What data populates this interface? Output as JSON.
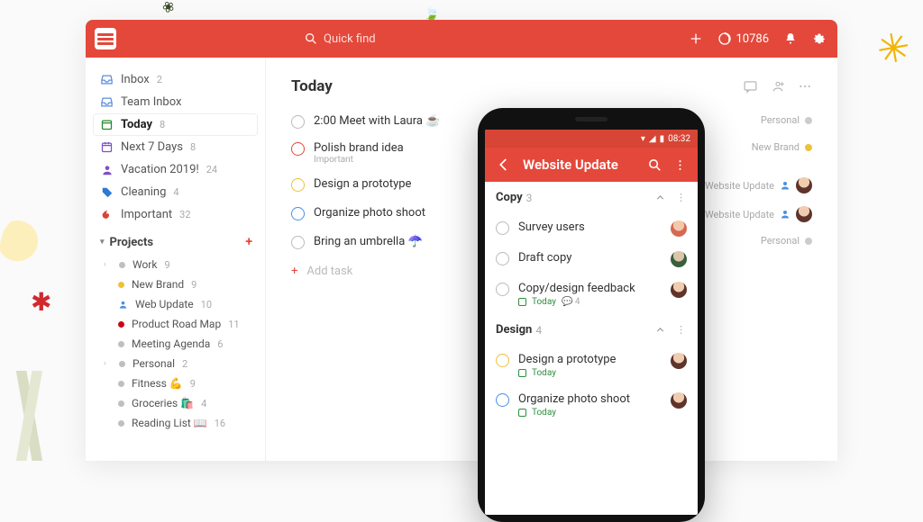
{
  "header": {
    "search_placeholder": "Quick find",
    "points": "10786"
  },
  "sidebar": {
    "items": [
      {
        "label": "Inbox",
        "count": "2"
      },
      {
        "label": "Team Inbox",
        "count": ""
      },
      {
        "label": "Today",
        "count": "8"
      },
      {
        "label": "Next 7 Days",
        "count": "8"
      },
      {
        "label": "Vacation 2019!",
        "count": "24"
      },
      {
        "label": "Cleaning",
        "count": "4"
      },
      {
        "label": "Important",
        "count": "32"
      }
    ],
    "projects_label": "Projects",
    "projects": [
      {
        "label": "Work",
        "count": "9",
        "color": "#bfbfbf",
        "depth": 0,
        "expand": true
      },
      {
        "label": "New Brand",
        "count": "9",
        "color": "#eec13a",
        "depth": 1
      },
      {
        "label": "Web Update",
        "count": "10",
        "color": "#4a90e2",
        "depth": 1,
        "person": true
      },
      {
        "label": "Product Road Map",
        "count": "11",
        "color": "#d0021b",
        "depth": 1
      },
      {
        "label": "Meeting Agenda",
        "count": "6",
        "color": "#bfbfbf",
        "depth": 1
      },
      {
        "label": "Personal",
        "count": "2",
        "color": "#bfbfbf",
        "depth": 0,
        "expand": true
      },
      {
        "label": "Fitness 💪",
        "count": "9",
        "color": "#bfbfbf",
        "depth": 1
      },
      {
        "label": "Groceries 🛍️",
        "count": "4",
        "color": "#bfbfbf",
        "depth": 1
      },
      {
        "label": "Reading List 📖",
        "count": "16",
        "color": "#bfbfbf",
        "depth": 1
      }
    ]
  },
  "main": {
    "title": "Today",
    "tasks": [
      {
        "text": "2:00 Meet with Laura ☕",
        "ring": "#bbb",
        "meta_label": "Personal",
        "meta_color": "#ccc",
        "sub": ""
      },
      {
        "text": "Polish brand idea",
        "ring": "#e4483b",
        "meta_label": "New Brand",
        "meta_color": "#eec13a",
        "sub": "Important"
      },
      {
        "text": "Design a prototype",
        "ring": "#eec13a",
        "meta_label": "Website Update",
        "meta_color": "#4a90e2",
        "avatar": true,
        "sub": ""
      },
      {
        "text": "Organize photo shoot",
        "ring": "#4a90e2",
        "meta_label": "Website Update",
        "meta_color": "#4a90e2",
        "avatar": true,
        "sub": ""
      },
      {
        "text": "Bring an umbrella ☂️",
        "ring": "#bbb",
        "meta_label": "Personal",
        "meta_color": "#ccc",
        "sub": ""
      }
    ],
    "add_label": "Add task"
  },
  "phone": {
    "time": "08:32",
    "title": "Website Update",
    "sections": [
      {
        "name": "Copy",
        "count": "3",
        "tasks": [
          {
            "text": "Survey users",
            "ring": "#bbb",
            "av": "av1"
          },
          {
            "text": "Draft copy",
            "ring": "#bbb",
            "av": "av2"
          },
          {
            "text": "Copy/design feedback",
            "ring": "#bbb",
            "av": "av3",
            "due": "Today",
            "comments": "4"
          }
        ]
      },
      {
        "name": "Design",
        "count": "4",
        "tasks": [
          {
            "text": "Design a prototype",
            "ring": "#eec13a",
            "av": "av3",
            "due": "Today"
          },
          {
            "text": "Organize photo shoot",
            "ring": "#4a90e2",
            "av": "av3",
            "due": "Today"
          }
        ]
      }
    ]
  }
}
